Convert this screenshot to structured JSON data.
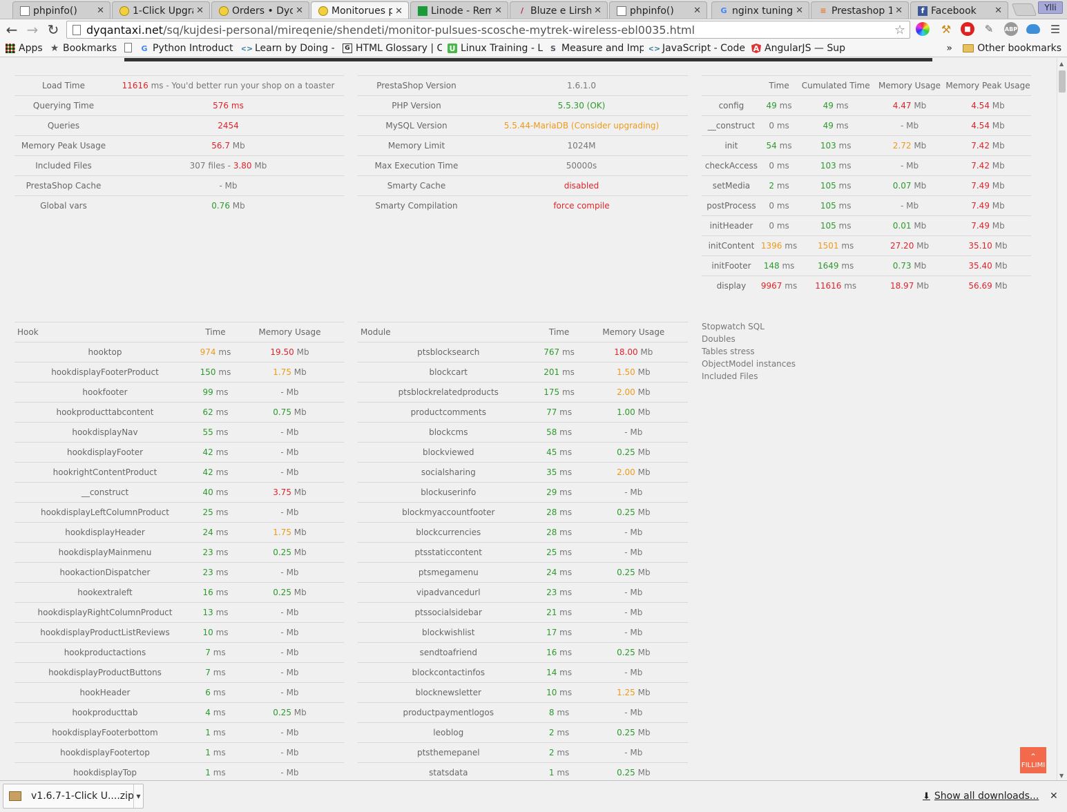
{
  "tabs": [
    {
      "title": "phpinfo()",
      "icon": "page-icon",
      "active": false
    },
    {
      "title": "1-Click Upgra",
      "icon": "prestashop-icon",
      "active": false
    },
    {
      "title": "Orders • Dyqa",
      "icon": "prestashop-icon",
      "active": false
    },
    {
      "title": "Monitorues p",
      "icon": "prestashop-icon",
      "active": true
    },
    {
      "title": "Linode - Remo",
      "icon": "linode-icon",
      "active": false
    },
    {
      "title": "Bluze e Lirshm",
      "icon": "feather-icon",
      "active": false
    },
    {
      "title": "phpinfo()",
      "icon": "page-icon",
      "active": false
    },
    {
      "title": "nginx tuning",
      "icon": "google-icon",
      "active": false
    },
    {
      "title": "Prestashop 1",
      "icon": "stackoverflow-icon",
      "active": false
    },
    {
      "title": "Facebook",
      "icon": "facebook-icon",
      "active": false
    }
  ],
  "tab_close": "✕",
  "user_name": "Ylli",
  "url": {
    "host": "dyqantaxi.net",
    "path": "/sq/kujdesi-personal/mireqenie/shendeti/monitor-pulsues-scosche-mytrek-wireless-ebl0035.html"
  },
  "bookmarks": [
    {
      "label": "Apps",
      "icon": "apps-grid-icon"
    },
    {
      "label": "Bookmarks",
      "icon": "star-icon"
    },
    {
      "label": "",
      "icon": "page-icon"
    },
    {
      "label": "Python Introduct",
      "icon": "google-icon"
    },
    {
      "label": "Learn by Doing - (",
      "icon": "code-icon"
    },
    {
      "label": "HTML Glossary | C",
      "icon": "glossary-icon"
    },
    {
      "label": "Linux Training - Li",
      "icon": "udemy-icon"
    },
    {
      "label": "Measure and Imp",
      "icon": "s-logo-icon"
    },
    {
      "label": "JavaScript - Code",
      "icon": "code-icon"
    },
    {
      "label": "AngularJS — Sup",
      "icon": "angular-icon"
    }
  ],
  "bookmarks_more": "»",
  "other_bookmarks": "Other bookmarks",
  "summary": [
    {
      "label": "Load Time",
      "parts": [
        {
          "t": "11616",
          "c": "red"
        },
        {
          "t": " ms - You'd better run your shop on a toaster",
          "c": "gray"
        }
      ]
    },
    {
      "label": "Querying Time",
      "parts": [
        {
          "t": "576",
          "c": "red"
        },
        {
          "t": " ms",
          "c": "red"
        }
      ]
    },
    {
      "label": "Queries",
      "parts": [
        {
          "t": "2454",
          "c": "red"
        }
      ]
    },
    {
      "label": "Memory Peak Usage",
      "parts": [
        {
          "t": "56.7",
          "c": "red"
        },
        {
          "t": " Mb",
          "c": "gray"
        }
      ]
    },
    {
      "label": "Included Files",
      "parts": [
        {
          "t": "307 files - ",
          "c": "gray"
        },
        {
          "t": "3.80",
          "c": "red"
        },
        {
          "t": " Mb",
          "c": "gray"
        }
      ]
    },
    {
      "label": "PrestaShop Cache",
      "parts": [
        {
          "t": "- Mb",
          "c": "gray"
        }
      ]
    },
    {
      "label": "Global vars",
      "parts": [
        {
          "t": "0.76",
          "c": "green"
        },
        {
          "t": " Mb",
          "c": "gray"
        }
      ]
    }
  ],
  "config": [
    {
      "label": "PrestaShop Version",
      "value": "1.6.1.0",
      "c": "gray"
    },
    {
      "label": "PHP Version",
      "value": "5.5.30 (OK)",
      "c": "green"
    },
    {
      "label": "MySQL Version",
      "value": "5.5.44-MariaDB (Consider upgrading)",
      "c": "orange"
    },
    {
      "label": "Memory Limit",
      "value": "1024M",
      "c": "gray"
    },
    {
      "label": "Max Execution Time",
      "value": "50000s",
      "c": "gray"
    },
    {
      "label": "Smarty Cache",
      "value": "disabled",
      "c": "red"
    },
    {
      "label": "Smarty Compilation",
      "value": "force compile",
      "c": "red"
    }
  ],
  "steps_header": [
    "",
    "Time",
    "Cumulated Time",
    "Memory Usage",
    "Memory Peak Usage"
  ],
  "steps": [
    {
      "name": "config",
      "time": "49",
      "tc": "green",
      "cum": "49",
      "cc": "green",
      "mem": "4.47",
      "mc": "red",
      "peak": "4.54",
      "pc": "red"
    },
    {
      "name": "__construct",
      "time": "0",
      "tc": "gray",
      "cum": "49",
      "cc": "green",
      "mem": "-",
      "mc": "gray",
      "peak": "4.54",
      "pc": "red"
    },
    {
      "name": "init",
      "time": "54",
      "tc": "green",
      "cum": "103",
      "cc": "green",
      "mem": "2.72",
      "mc": "orange",
      "peak": "7.42",
      "pc": "red"
    },
    {
      "name": "checkAccess",
      "time": "0",
      "tc": "gray",
      "cum": "103",
      "cc": "green",
      "mem": "-",
      "mc": "gray",
      "peak": "7.42",
      "pc": "red"
    },
    {
      "name": "setMedia",
      "time": "2",
      "tc": "green",
      "cum": "105",
      "cc": "green",
      "mem": "0.07",
      "mc": "green",
      "peak": "7.49",
      "pc": "red"
    },
    {
      "name": "postProcess",
      "time": "0",
      "tc": "gray",
      "cum": "105",
      "cc": "green",
      "mem": "-",
      "mc": "gray",
      "peak": "7.49",
      "pc": "red"
    },
    {
      "name": "initHeader",
      "time": "0",
      "tc": "gray",
      "cum": "105",
      "cc": "green",
      "mem": "0.01",
      "mc": "green",
      "peak": "7.49",
      "pc": "red"
    },
    {
      "name": "initContent",
      "time": "1396",
      "tc": "orange",
      "cum": "1501",
      "cc": "orange",
      "mem": "27.20",
      "mc": "red",
      "peak": "35.10",
      "pc": "red"
    },
    {
      "name": "initFooter",
      "time": "148",
      "tc": "green",
      "cum": "1649",
      "cc": "green",
      "mem": "0.73",
      "mc": "green",
      "peak": "35.40",
      "pc": "red"
    },
    {
      "name": "display",
      "time": "9967",
      "tc": "red",
      "cum": "11616",
      "cc": "red",
      "mem": "18.97",
      "mc": "red",
      "peak": "56.69",
      "pc": "red"
    }
  ],
  "hooks_header": [
    "Hook",
    "Time",
    "Memory Usage"
  ],
  "hooks": [
    {
      "name": "hooktop",
      "time": "974",
      "tc": "orange",
      "mem": "19.50",
      "mc": "red"
    },
    {
      "name": "hookdisplayFooterProduct",
      "time": "150",
      "tc": "green",
      "mem": "1.75",
      "mc": "orange"
    },
    {
      "name": "hookfooter",
      "time": "99",
      "tc": "green",
      "mem": "-",
      "mc": "gray"
    },
    {
      "name": "hookproducttabcontent",
      "time": "62",
      "tc": "green",
      "mem": "0.75",
      "mc": "green"
    },
    {
      "name": "hookdisplayNav",
      "time": "55",
      "tc": "green",
      "mem": "-",
      "mc": "gray"
    },
    {
      "name": "hookdisplayFooter",
      "time": "42",
      "tc": "green",
      "mem": "-",
      "mc": "gray"
    },
    {
      "name": "hookrightContentProduct",
      "time": "42",
      "tc": "green",
      "mem": "-",
      "mc": "gray"
    },
    {
      "name": "__construct",
      "time": "40",
      "tc": "green",
      "mem": "3.75",
      "mc": "red"
    },
    {
      "name": "hookdisplayLeftColumnProduct",
      "time": "25",
      "tc": "green",
      "mem": "-",
      "mc": "gray"
    },
    {
      "name": "hookdisplayHeader",
      "time": "24",
      "tc": "green",
      "mem": "1.75",
      "mc": "orange"
    },
    {
      "name": "hookdisplayMainmenu",
      "time": "23",
      "tc": "green",
      "mem": "0.25",
      "mc": "green"
    },
    {
      "name": "hookactionDispatcher",
      "time": "23",
      "tc": "green",
      "mem": "-",
      "mc": "gray"
    },
    {
      "name": "hookextraleft",
      "time": "16",
      "tc": "green",
      "mem": "0.25",
      "mc": "green"
    },
    {
      "name": "hookdisplayRightColumnProduct",
      "time": "13",
      "tc": "green",
      "mem": "-",
      "mc": "gray"
    },
    {
      "name": "hookdisplayProductListReviews",
      "time": "10",
      "tc": "green",
      "mem": "-",
      "mc": "gray"
    },
    {
      "name": "hookproductactions",
      "time": "7",
      "tc": "green",
      "mem": "-",
      "mc": "gray"
    },
    {
      "name": "hookdisplayProductButtons",
      "time": "7",
      "tc": "green",
      "mem": "-",
      "mc": "gray"
    },
    {
      "name": "hookHeader",
      "time": "6",
      "tc": "green",
      "mem": "-",
      "mc": "gray"
    },
    {
      "name": "hookproducttab",
      "time": "4",
      "tc": "green",
      "mem": "0.25",
      "mc": "green"
    },
    {
      "name": "hookdisplayFooterbottom",
      "time": "1",
      "tc": "green",
      "mem": "-",
      "mc": "gray"
    },
    {
      "name": "hookdisplayFootertop",
      "time": "1",
      "tc": "green",
      "mem": "-",
      "mc": "gray"
    },
    {
      "name": "hookdisplayTop",
      "time": "1",
      "tc": "green",
      "mem": "-",
      "mc": "gray"
    }
  ],
  "modules_header": [
    "Module",
    "Time",
    "Memory Usage"
  ],
  "modules": [
    {
      "name": "ptsblocksearch",
      "time": "767",
      "tc": "green",
      "mem": "18.00",
      "mc": "red"
    },
    {
      "name": "blockcart",
      "time": "201",
      "tc": "green",
      "mem": "1.50",
      "mc": "orange"
    },
    {
      "name": "ptsblockrelatedproducts",
      "time": "175",
      "tc": "green",
      "mem": "2.00",
      "mc": "orange"
    },
    {
      "name": "productcomments",
      "time": "77",
      "tc": "green",
      "mem": "1.00",
      "mc": "green"
    },
    {
      "name": "blockcms",
      "time": "58",
      "tc": "green",
      "mem": "-",
      "mc": "gray"
    },
    {
      "name": "blockviewed",
      "time": "45",
      "tc": "green",
      "mem": "0.25",
      "mc": "green"
    },
    {
      "name": "socialsharing",
      "time": "35",
      "tc": "green",
      "mem": "2.00",
      "mc": "orange"
    },
    {
      "name": "blockuserinfo",
      "time": "29",
      "tc": "green",
      "mem": "-",
      "mc": "gray"
    },
    {
      "name": "blockmyaccountfooter",
      "time": "28",
      "tc": "green",
      "mem": "0.25",
      "mc": "green"
    },
    {
      "name": "blockcurrencies",
      "time": "28",
      "tc": "green",
      "mem": "-",
      "mc": "gray"
    },
    {
      "name": "ptsstaticcontent",
      "time": "25",
      "tc": "green",
      "mem": "-",
      "mc": "gray"
    },
    {
      "name": "ptsmegamenu",
      "time": "24",
      "tc": "green",
      "mem": "0.25",
      "mc": "green"
    },
    {
      "name": "vipadvancedurl",
      "time": "23",
      "tc": "green",
      "mem": "-",
      "mc": "gray"
    },
    {
      "name": "ptssocialsidebar",
      "time": "21",
      "tc": "green",
      "mem": "-",
      "mc": "gray"
    },
    {
      "name": "blockwishlist",
      "time": "17",
      "tc": "green",
      "mem": "-",
      "mc": "gray"
    },
    {
      "name": "sendtoafriend",
      "time": "16",
      "tc": "green",
      "mem": "0.25",
      "mc": "green"
    },
    {
      "name": "blockcontactinfos",
      "time": "14",
      "tc": "green",
      "mem": "-",
      "mc": "gray"
    },
    {
      "name": "blocknewsletter",
      "time": "10",
      "tc": "green",
      "mem": "1.25",
      "mc": "orange"
    },
    {
      "name": "productpaymentlogos",
      "time": "8",
      "tc": "green",
      "mem": "-",
      "mc": "gray"
    },
    {
      "name": "leoblog",
      "time": "2",
      "tc": "green",
      "mem": "0.25",
      "mc": "green"
    },
    {
      "name": "ptsthemepanel",
      "time": "2",
      "tc": "green",
      "mem": "-",
      "mc": "gray"
    },
    {
      "name": "statsdata",
      "time": "1",
      "tc": "green",
      "mem": "0.25",
      "mc": "green"
    }
  ],
  "units": {
    "ms": " ms",
    "mb": " Mb"
  },
  "debug_links": [
    "Stopwatch SQL",
    "Doubles",
    "Tables stress",
    "ObjectModel instances",
    "Included Files"
  ],
  "scroll_top_label": "FILLIMI",
  "download": {
    "filename": "v1.6.7-1-Click U....zip",
    "show_all": "Show all downloads..."
  },
  "colors": {
    "red": "#e0242a",
    "green": "#2c9a2c",
    "orange": "#ee9a18",
    "gray": "#777777",
    "fab": "#f26a4b"
  }
}
